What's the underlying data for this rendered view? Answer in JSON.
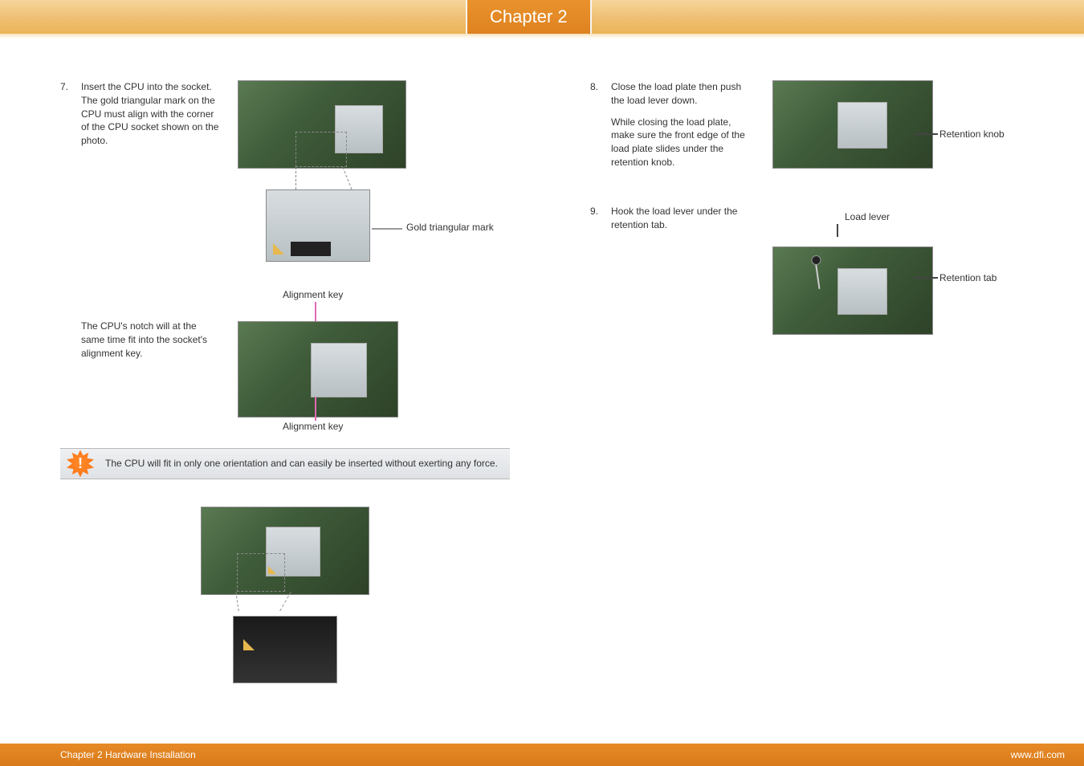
{
  "header": {
    "chapter_label": "Chapter 2"
  },
  "left": {
    "step7": {
      "num": "7.",
      "text": "Insert the CPU into the socket. The gold triangular mark on the CPU must align with the corner of the CPU socket shown on the photo."
    },
    "gold_mark_label": "Gold triangular mark",
    "alignment_key_top": "Alignment key",
    "alignment_key_bottom": "Alignment key",
    "notch_text": "The CPU's notch will at the same time fit into the socket's alignment key.",
    "caution_text": "The CPU will fit in only one orientation and can easily be inserted without exerting any force."
  },
  "right": {
    "step8": {
      "num": "8.",
      "text1": "Close the load plate then push the load lever down.",
      "text2": "While closing the load plate, make sure the front edge of the load plate slides under the retention knob."
    },
    "step9": {
      "num": "9.",
      "text": "Hook the load lever under the retention tab."
    },
    "retention_knob_label": "Retention knob",
    "retention_tab_label": "Retention tab",
    "load_lever_label": "Load lever"
  },
  "footer": {
    "left": "Chapter 2 Hardware Installation",
    "right": "www.dfi.com"
  }
}
